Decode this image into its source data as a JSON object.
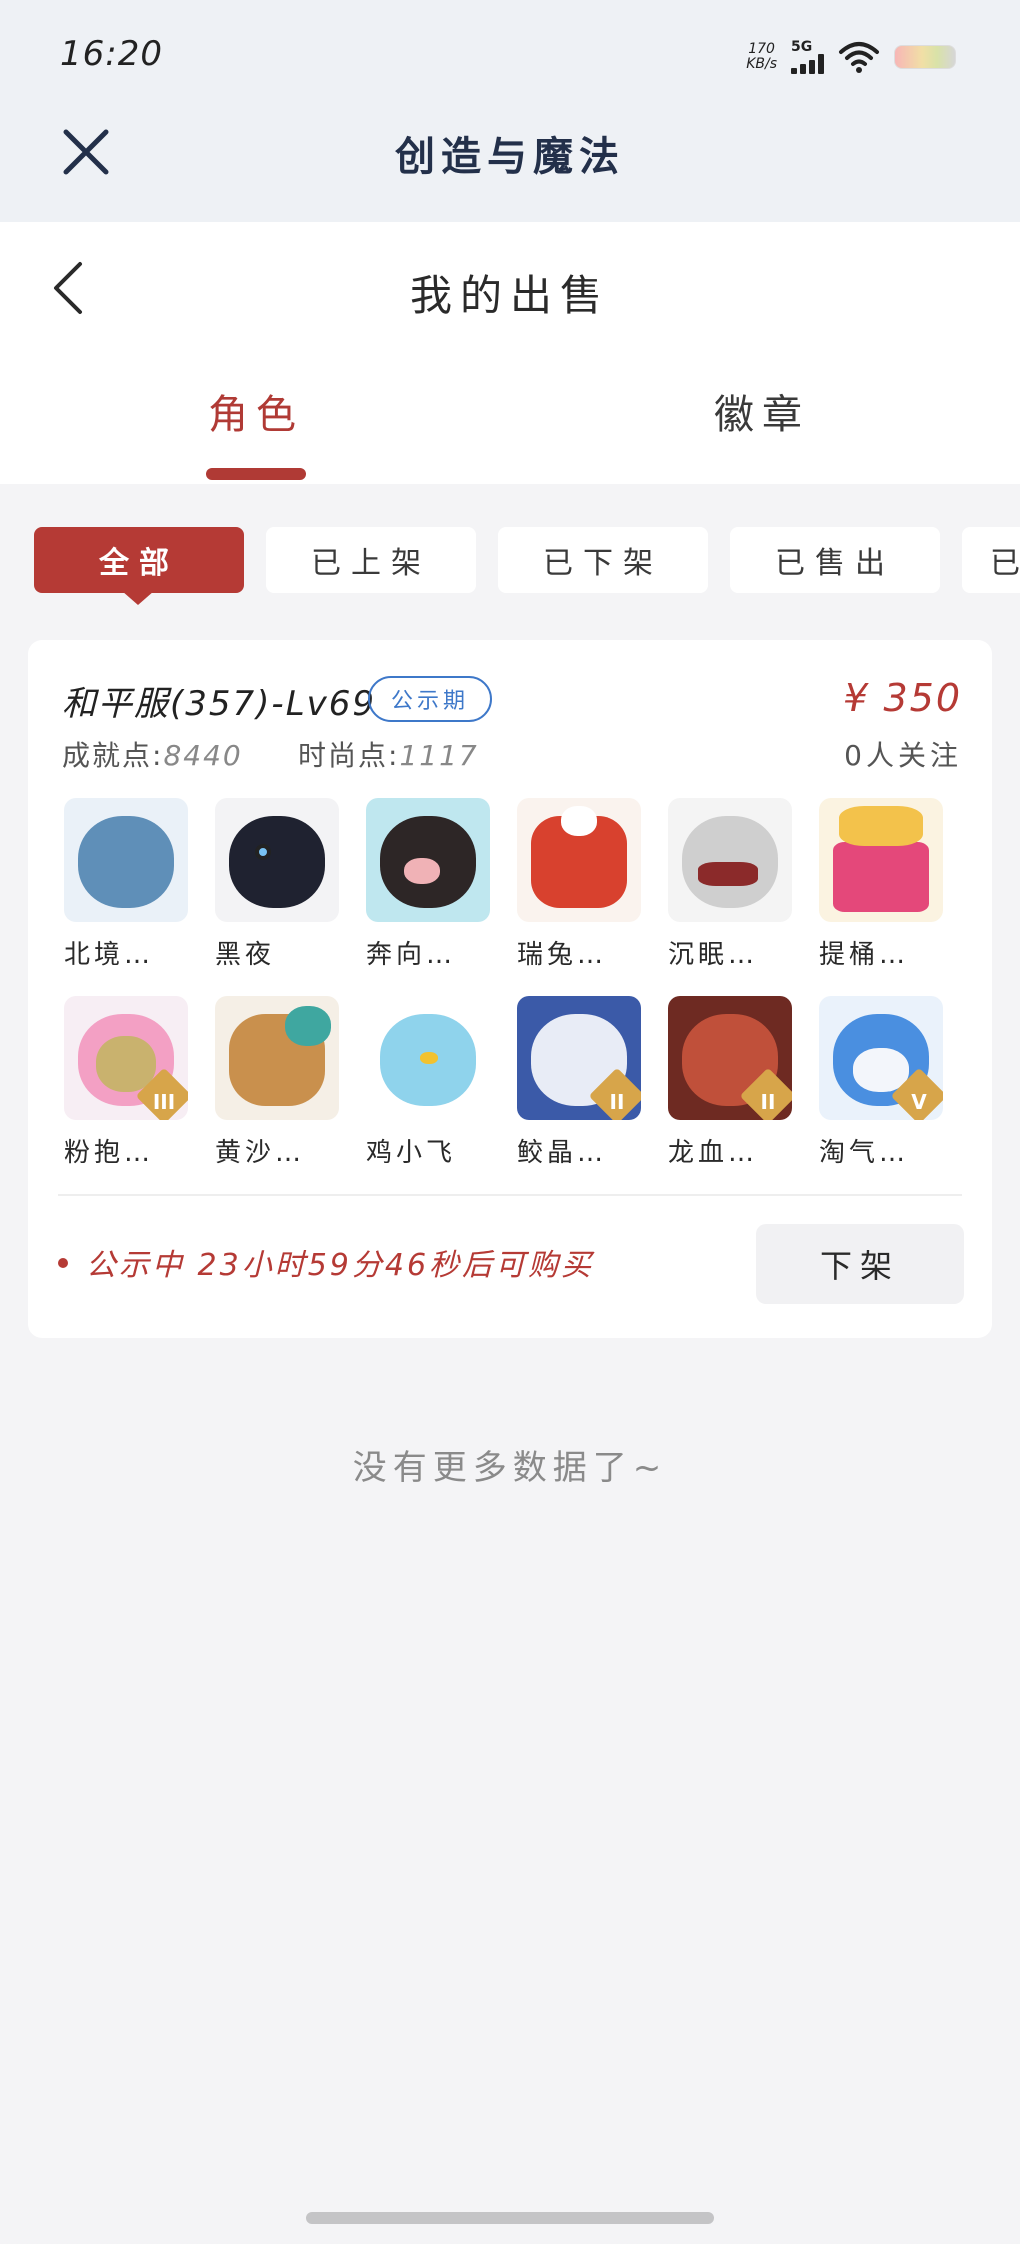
{
  "status_bar": {
    "time": "16:20",
    "net_speed_value": "170",
    "net_speed_unit": "KB/s",
    "network": "5G"
  },
  "app": {
    "title": "创造与魔法"
  },
  "page": {
    "title": "我的出售"
  },
  "tabs": [
    {
      "label": "角色",
      "active": true
    },
    {
      "label": "徽章",
      "active": false
    }
  ],
  "filters": [
    {
      "label": "全部",
      "active": true
    },
    {
      "label": "已上架",
      "active": false
    },
    {
      "label": "已下架",
      "active": false
    },
    {
      "label": "已售出",
      "active": false
    },
    {
      "label": "已",
      "active": false
    }
  ],
  "listing": {
    "name": "和平服(357)-Lv69",
    "badge": "公示期",
    "price": "¥ 350",
    "achievement_label": "成就点:",
    "achievement_value": "8440",
    "fashion_label": "时尚点:",
    "fashion_value": "1117",
    "followers": "0人关注",
    "pets": [
      {
        "name": "北境…",
        "icon": "ice-dragon-icon",
        "color": "#5f8fb8"
      },
      {
        "name": "黑夜",
        "icon": "black-cat-icon",
        "color": "#1f2230"
      },
      {
        "name": "奔向…",
        "icon": "pig-icon",
        "color": "#e9c8b4"
      },
      {
        "name": "瑞兔…",
        "icon": "drum-rabbit-icon",
        "color": "#d8412e"
      },
      {
        "name": "沉眠…",
        "icon": "shark-icon",
        "color": "#d9d9d9"
      },
      {
        "name": "提桶…",
        "icon": "bucket-icon",
        "color": "#e4487a"
      },
      {
        "name": "粉抱…",
        "icon": "pink-bear-icon",
        "color": "#f3a0c4",
        "tier": "III"
      },
      {
        "name": "黄沙…",
        "icon": "sand-crab-icon",
        "color": "#c9904d"
      },
      {
        "name": "鸡小飞",
        "icon": "blue-chick-icon",
        "color": "#8fd3ec"
      },
      {
        "name": "鲛晶…",
        "icon": "white-tiger-icon",
        "color": "#7c8fc9",
        "tier": "II"
      },
      {
        "name": "龙血…",
        "icon": "red-dragon-icon",
        "color": "#c0503a",
        "tier": "II"
      },
      {
        "name": "淘气…",
        "icon": "blue-dog-icon",
        "color": "#4a8fe0",
        "tier": "V"
      }
    ],
    "notice": "公示中 23小时59分46秒后可购买",
    "delist_label": "下架"
  },
  "footer": {
    "no_more": "没有更多数据了~"
  },
  "colors": {
    "accent": "#b53a35",
    "badge_blue": "#3e78c9"
  }
}
